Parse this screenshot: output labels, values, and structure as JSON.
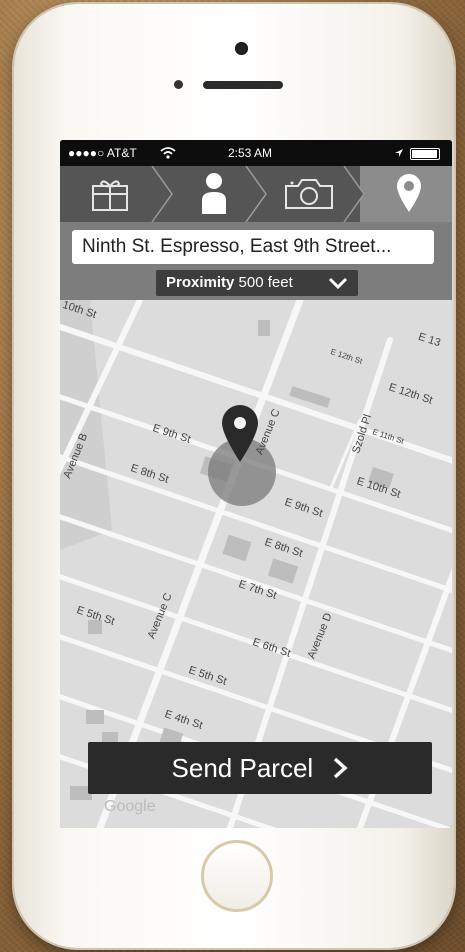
{
  "status_bar": {
    "carrier": "●●●●○ AT&T",
    "time": "2:53 AM"
  },
  "steps": [
    {
      "icon": "gift-icon",
      "active": false
    },
    {
      "icon": "person-icon",
      "active": false
    },
    {
      "icon": "camera-icon",
      "active": false
    },
    {
      "icon": "location-pin-icon",
      "active": true
    }
  ],
  "search": {
    "value": "Ninth St. Espresso, East 9th Street..."
  },
  "proximity": {
    "label": "Proximity",
    "value": "500 feet"
  },
  "map": {
    "street_labels": [
      "10th St",
      "E 12th St",
      "E 13",
      "E 12th St",
      "E 11th St",
      "Szold Pl",
      "Avenue B",
      "E 9th St",
      "Avenue C",
      "E 8th St",
      "E 10th St",
      "E 9th St",
      "E 8th St",
      "E 7th St",
      "E 5th St",
      "Avenue C",
      "E 6th St",
      "Avenue D",
      "E 5th St",
      "E 4th St"
    ],
    "watermark": "Google"
  },
  "send_button": {
    "label": "Send Parcel"
  },
  "colors": {
    "nav_bg": "#555555",
    "active_step": "#8c8c8c",
    "button_bg": "#2a2a2a"
  }
}
